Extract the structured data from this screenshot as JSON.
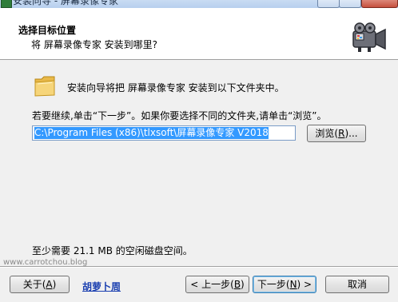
{
  "window": {
    "title": "安装向导 - 屏幕录像专家",
    "icons": {
      "app": "installer-icon",
      "minimize": "minimize-icon",
      "maximize": "maximize-icon",
      "close": "close-icon"
    }
  },
  "header": {
    "title": "选择目标位置",
    "subtitle": "将 屏幕录像专家 安装到哪里?",
    "icon": "camera-icon"
  },
  "body": {
    "folder_icon": "folder-icon",
    "folder_text": "安装向导将把 屏幕录像专家 安装到以下文件夹中。",
    "instruction": "若要继续,单击“下一步”。如果你要选择不同的文件夹,请单击“浏览”。",
    "install_path": "C:\\Program Files (x86)\\tlxsoft\\屏幕录像专家 V2018",
    "browse_label": "浏览(",
    "browse_key": "R",
    "browse_suffix": ")...",
    "space_required": "至少需要 21.1 MB 的空闲磁盘空间。"
  },
  "watermark": "www.carrotchou.blog",
  "footer": {
    "about_label": "关于(",
    "about_key": "A",
    "about_suffix": ")",
    "author_link": "胡萝卜周",
    "back_label": "< 上一步(",
    "back_key": "B",
    "back_suffix": ")",
    "next_label": "下一步(",
    "next_key": "N",
    "next_suffix": ") >",
    "cancel_label": "取消"
  }
}
